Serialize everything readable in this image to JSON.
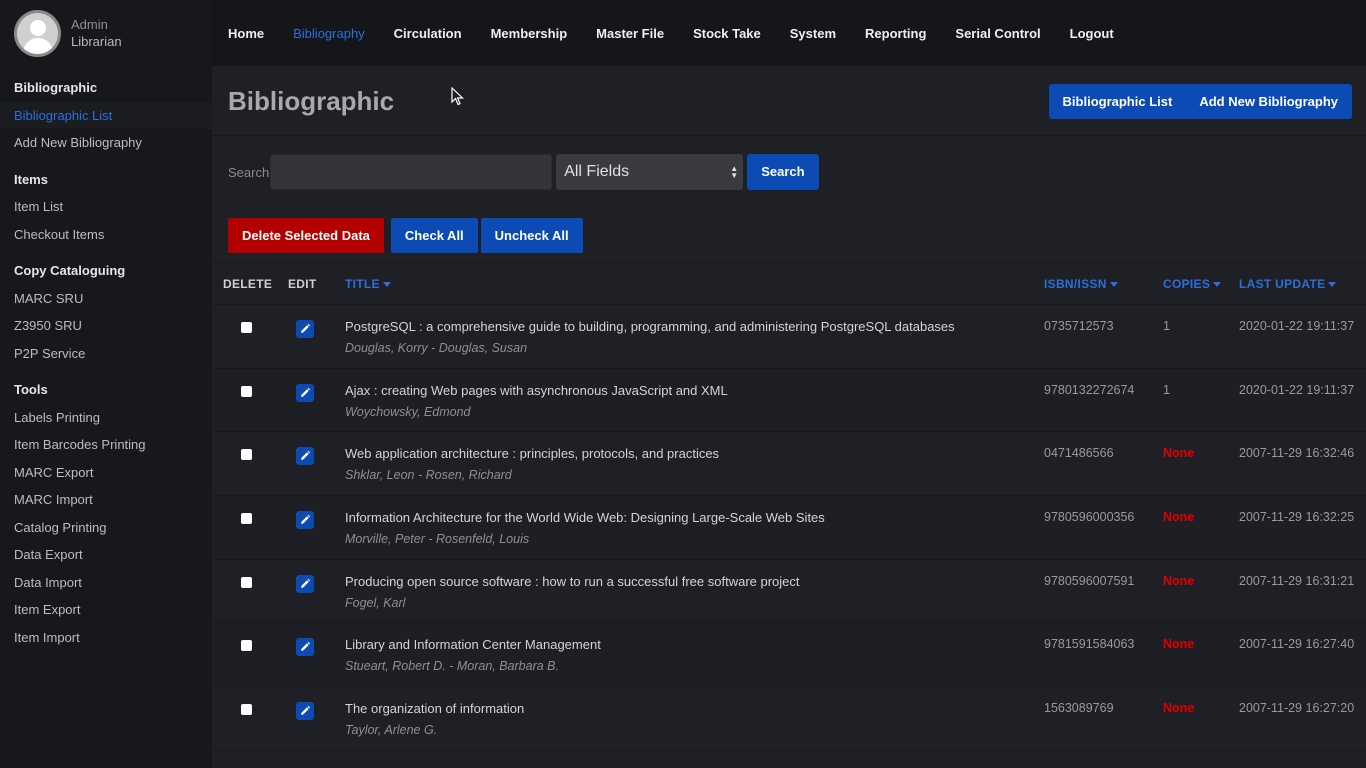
{
  "user": {
    "role": "Admin",
    "name": "Librarian"
  },
  "nav": [
    "Home",
    "Bibliography",
    "Circulation",
    "Membership",
    "Master File",
    "Stock Take",
    "System",
    "Reporting",
    "Serial Control",
    "Logout"
  ],
  "nav_active": "Bibliography",
  "sidebar": {
    "bibliographic": {
      "heading": "Bibliographic",
      "items": [
        "Bibliographic List",
        "Add New Bibliography"
      ]
    },
    "items": {
      "heading": "Items",
      "items": [
        "Item List",
        "Checkout Items"
      ]
    },
    "copy": {
      "heading": "Copy Cataloguing",
      "items": [
        "MARC SRU",
        "Z3950 SRU",
        "P2P Service"
      ]
    },
    "tools": {
      "heading": "Tools",
      "items": [
        "Labels Printing",
        "Item Barcodes Printing",
        "MARC Export",
        "MARC Import",
        "Catalog Printing",
        "Data Export",
        "Data Import",
        "Item Export",
        "Item Import"
      ]
    }
  },
  "page": {
    "title": "Bibliographic",
    "header_buttons": [
      "Bibliographic List",
      "Add New Bibliography"
    ]
  },
  "search": {
    "label": "Search",
    "value": "",
    "field_selected": "All Fields",
    "button": "Search"
  },
  "actions": {
    "delete": "Delete Selected Data",
    "check_all": "Check All",
    "uncheck_all": "Uncheck All"
  },
  "table": {
    "headers": {
      "delete": "DELETE",
      "edit": "EDIT",
      "title": "TITLE",
      "isbn": "ISBN/ISSN",
      "copies": "COPIES",
      "updated": "LAST UPDATE"
    },
    "rows": [
      {
        "title": "PostgreSQL : a comprehensive guide to building, programming, and administering PostgreSQL databases",
        "author": "Douglas, Korry - Douglas, Susan",
        "isbn": "0735712573",
        "copies": "1",
        "updated": "2020-01-22 19:11:37"
      },
      {
        "title": "Ajax : creating Web pages with asynchronous JavaScript and XML",
        "author": "Woychowsky, Edmond",
        "isbn": "9780132272674",
        "copies": "1",
        "updated": "2020-01-22 19:11:37"
      },
      {
        "title": "Web application architecture : principles, protocols, and practices",
        "author": "Shklar, Leon - Rosen, Richard",
        "isbn": "0471486566",
        "copies": "None",
        "updated": "2007-11-29 16:32:46"
      },
      {
        "title": "Information Architecture for the World Wide Web: Designing Large-Scale Web Sites",
        "author": "Morville, Peter - Rosenfeld, Louis",
        "isbn": "9780596000356",
        "copies": "None",
        "updated": "2007-11-29 16:32:25"
      },
      {
        "title": "Producing open source software : how to run a successful free software project",
        "author": "Fogel, Karl",
        "isbn": "9780596007591",
        "copies": "None",
        "updated": "2007-11-29 16:31:21"
      },
      {
        "title": "Library and Information Center Management",
        "author": "Stueart, Robert D. - Moran, Barbara B.",
        "isbn": "9781591584063",
        "copies": "None",
        "updated": "2007-11-29 16:27:40"
      },
      {
        "title": "The organization of information",
        "author": "Taylor, Arlene G.",
        "isbn": "1563089769",
        "copies": "None",
        "updated": "2007-11-29 16:27:20"
      }
    ]
  },
  "colors": {
    "accent": "#0b4bb3",
    "danger": "#b30000",
    "none_text": "#e00000"
  }
}
